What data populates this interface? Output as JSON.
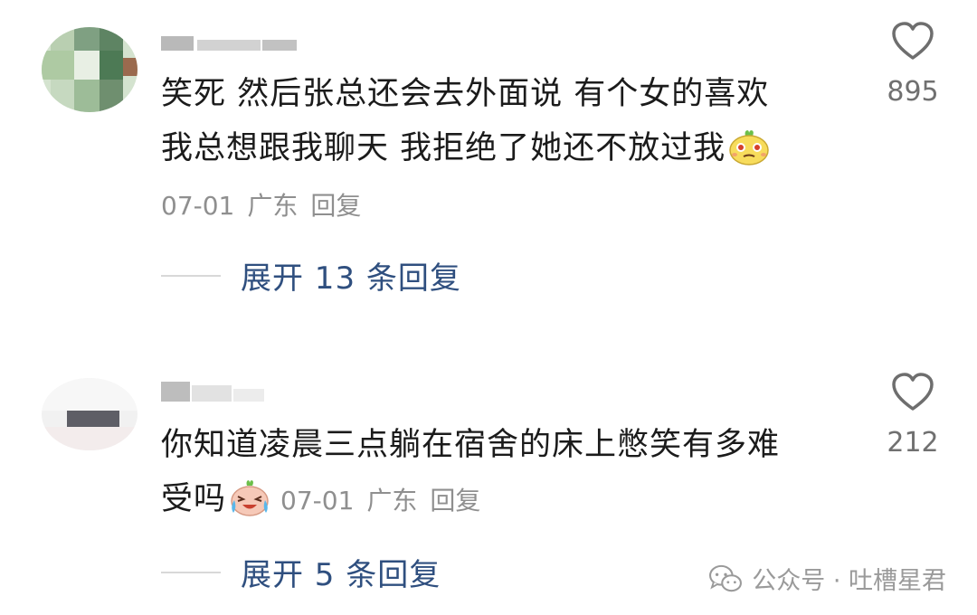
{
  "comments": [
    {
      "text_line1": "笑死 然后张总还会去外面说 有个女的喜欢",
      "text_line2": "我总想跟我聊天 我拒绝了她还不放过我",
      "emoji": "smirk-emoji",
      "date": "07-01",
      "location": "广东",
      "reply_label": "回复",
      "likes": "895",
      "expand_label": "展开 13 条回复"
    },
    {
      "text_line1": "你知道凌晨三点躺在宿舍的床上憋笑有多难",
      "text_line2": "受吗",
      "emoji": "crying-laughing-emoji",
      "date": "07-01",
      "location": "广东",
      "reply_label": "回复",
      "likes": "212",
      "expand_label": "展开 5 条回复"
    }
  ],
  "watermark": {
    "text": "公众号 · 吐槽星君",
    "icon": "wechat-icon"
  },
  "colors": {
    "text": "#1b1b1b",
    "meta": "#8f8f8f",
    "expand": "#2f4f7f",
    "like_count": "#707070"
  }
}
